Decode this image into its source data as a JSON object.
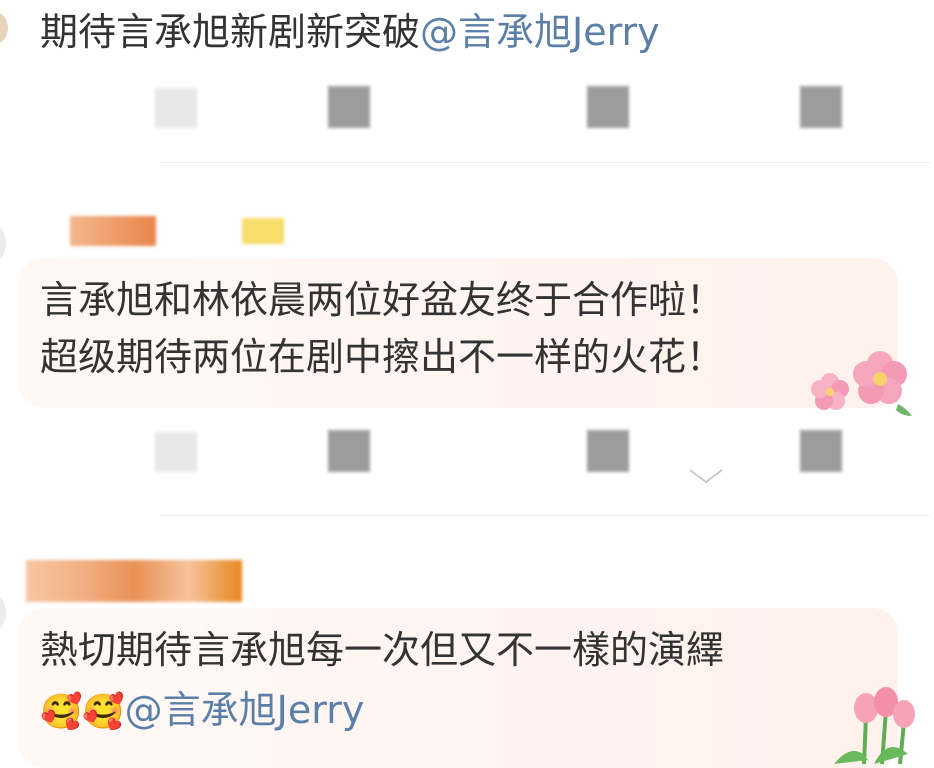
{
  "comments": [
    {
      "text": "期待言承旭新剧新突破",
      "mention": "@言承旭Jerry"
    },
    {
      "line1": "言承旭和林依晨两位好盆友终于合作啦！",
      "line2": "超级期待两位在剧中擦出不一样的火花！",
      "sticker": "cherry-blossom-icon"
    },
    {
      "text": "熱切期待言承旭每一次但又不一樣的演繹",
      "emojis": "🥰🥰",
      "mention": "@言承旭Jerry",
      "sticker": "tulip-icon"
    }
  ],
  "colors": {
    "text": "#333333",
    "mention": "#5b7fa6",
    "bubble": "#fff3ef"
  }
}
